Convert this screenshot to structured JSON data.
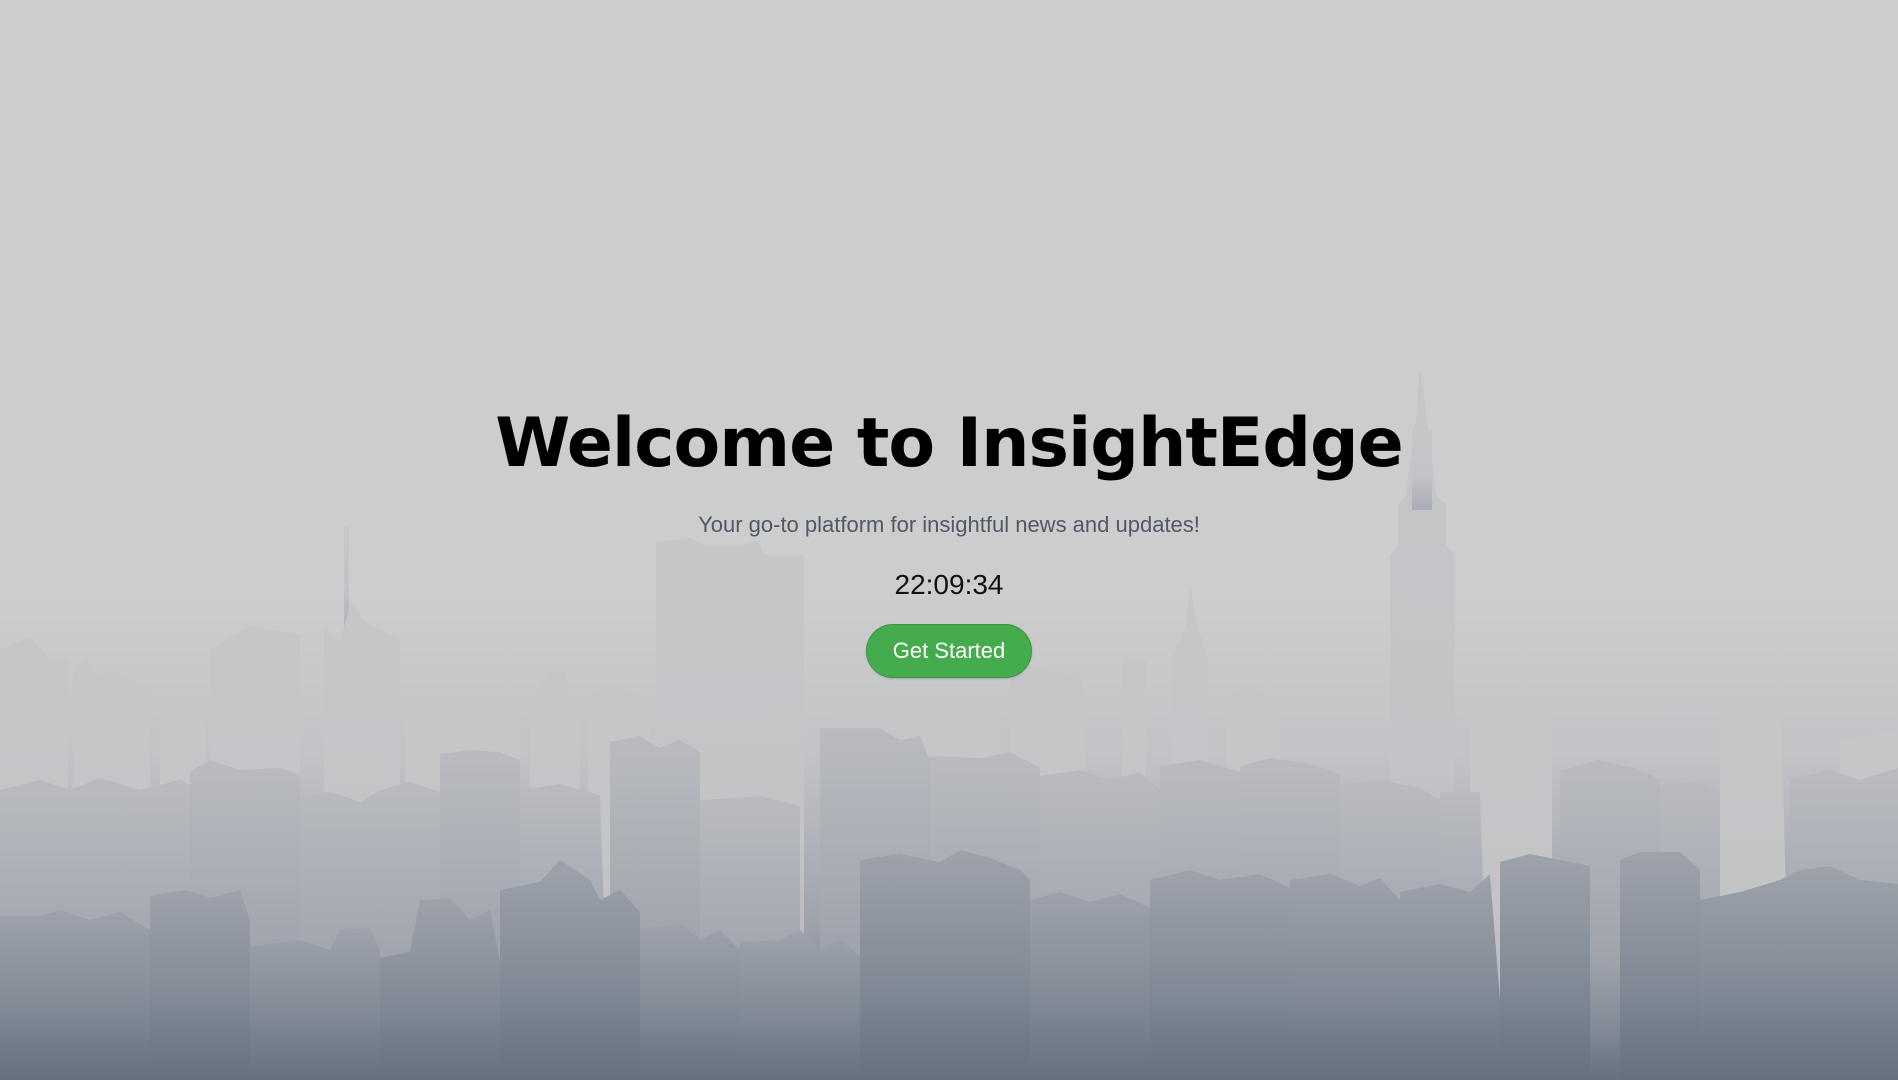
{
  "hero": {
    "title": "Welcome to InsightEdge",
    "subtitle": "Your go-to platform for insightful news and updates!",
    "clock": "22:09:34",
    "cta_label": "Get Started"
  },
  "background": {
    "image": "city-skyline-silhouette",
    "sky_color": "#cdcdcd",
    "ground_color": "#66717f"
  },
  "colors": {
    "title": "#000000",
    "subtitle": "#4f5965",
    "cta_background": "#45ac4e",
    "cta_text": "#ffffff"
  }
}
